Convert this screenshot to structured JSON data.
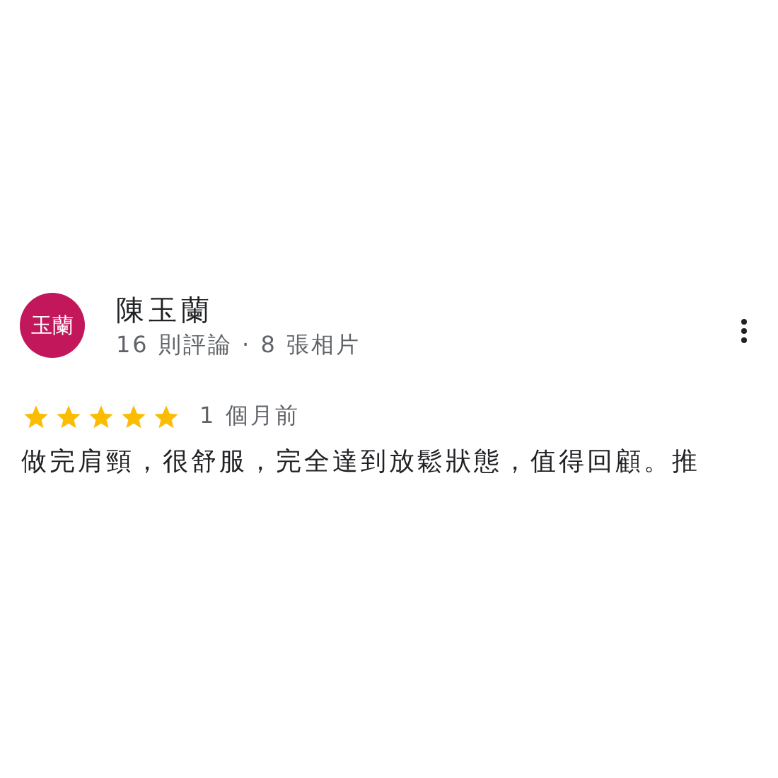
{
  "review": {
    "avatar": {
      "initials": "玉蘭",
      "color": "#c2185b"
    },
    "author": "陳玉蘭",
    "meta": "16 則評論 · 8 張相片",
    "stars": 5,
    "time": "1 個月前",
    "text": "做完肩頸，很舒服，完全達到放鬆狀態，值得回顧。推"
  }
}
